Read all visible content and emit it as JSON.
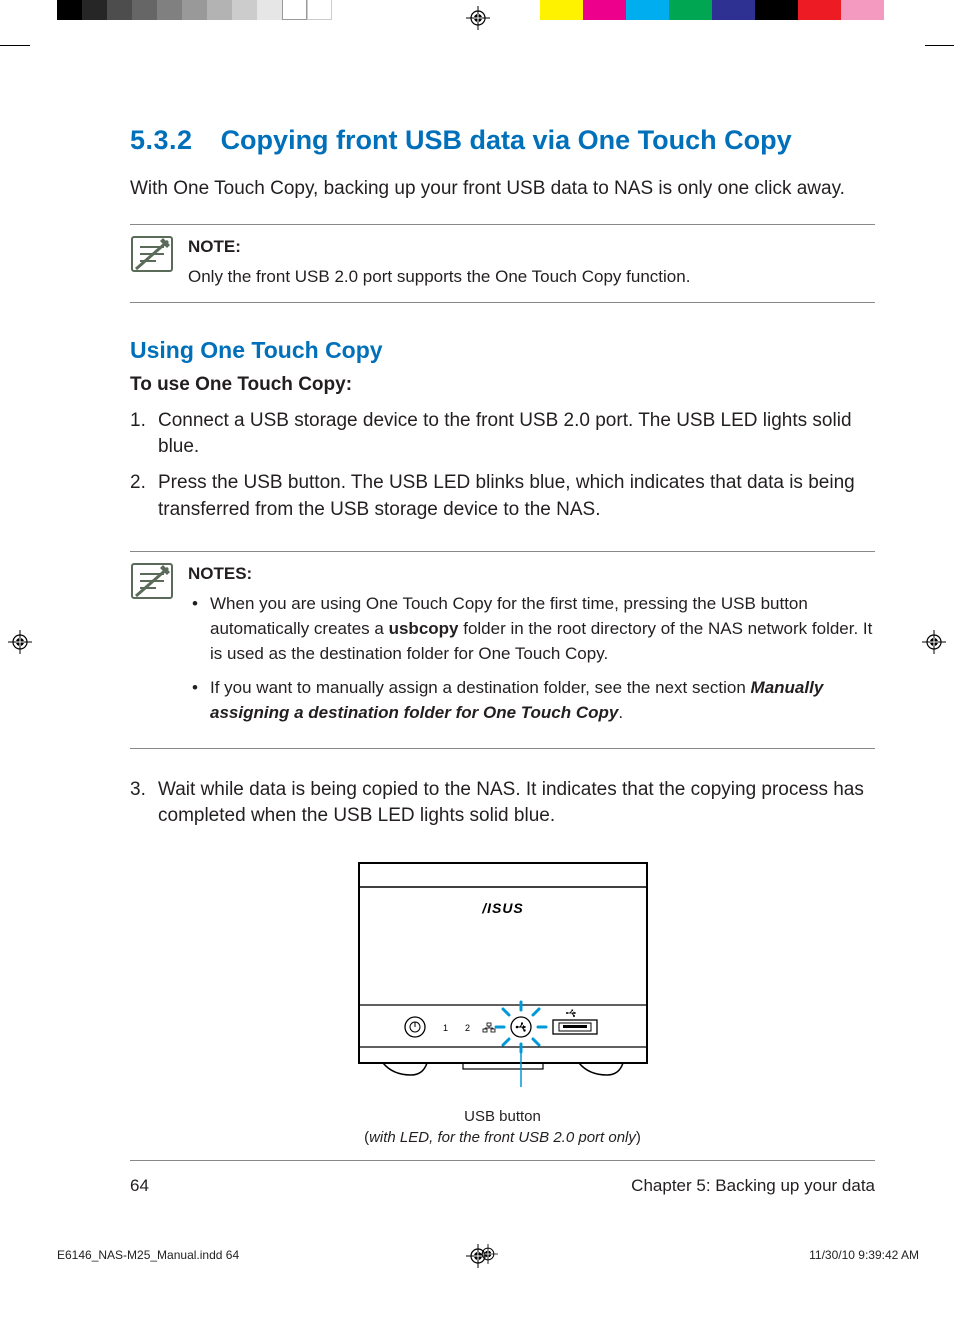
{
  "heading": {
    "number": "5.3.2",
    "title": "Copying front USB data via One Touch Copy"
  },
  "intro": "With One Touch Copy, backing up your front USB data to NAS is only one click away.",
  "note1": {
    "label": "NOTE:",
    "text": "Only the front USB 2.0 port supports the One Touch Copy function."
  },
  "subheading": "Using One Touch Copy",
  "instruction_label": "To use One Touch Copy:",
  "steps": {
    "s1": "Connect a USB storage device to the front USB 2.0 port. The USB LED lights solid blue.",
    "s2": "Press the USB button. The USB LED blinks blue, which indicates that data is being transferred from the USB storage device to the NAS.",
    "s3": "Wait while data is being copied to the NAS. It indicates that the copying process has completed when the USB LED lights solid blue."
  },
  "note2": {
    "label": "NOTES:",
    "b1_pre": "When you are using One Touch Copy for the first time, pressing the USB button automatically creates a ",
    "b1_bold": "usbcopy",
    "b1_post": " folder in the root directory of the NAS network folder. It is used as the destination folder for One Touch Copy.",
    "b2_pre": "If you want to manually assign a destination folder, see the next section ",
    "b2_bi": "Manually assigning a destination folder for One Touch Copy",
    "b2_post": "."
  },
  "device": {
    "logo": "ASUS",
    "label1": "1",
    "label2": "2"
  },
  "callout": {
    "line1": "USB button",
    "paren_open": "(",
    "line2": "with LED, for the front USB 2.0 port only",
    "paren_close": ")"
  },
  "footer": {
    "page_num": "64",
    "chapter": "Chapter 5: Backing up your data"
  },
  "slug": {
    "file": "E6146_NAS-M25_Manual.indd   64",
    "datetime": "11/30/10   9:39:42 AM"
  }
}
